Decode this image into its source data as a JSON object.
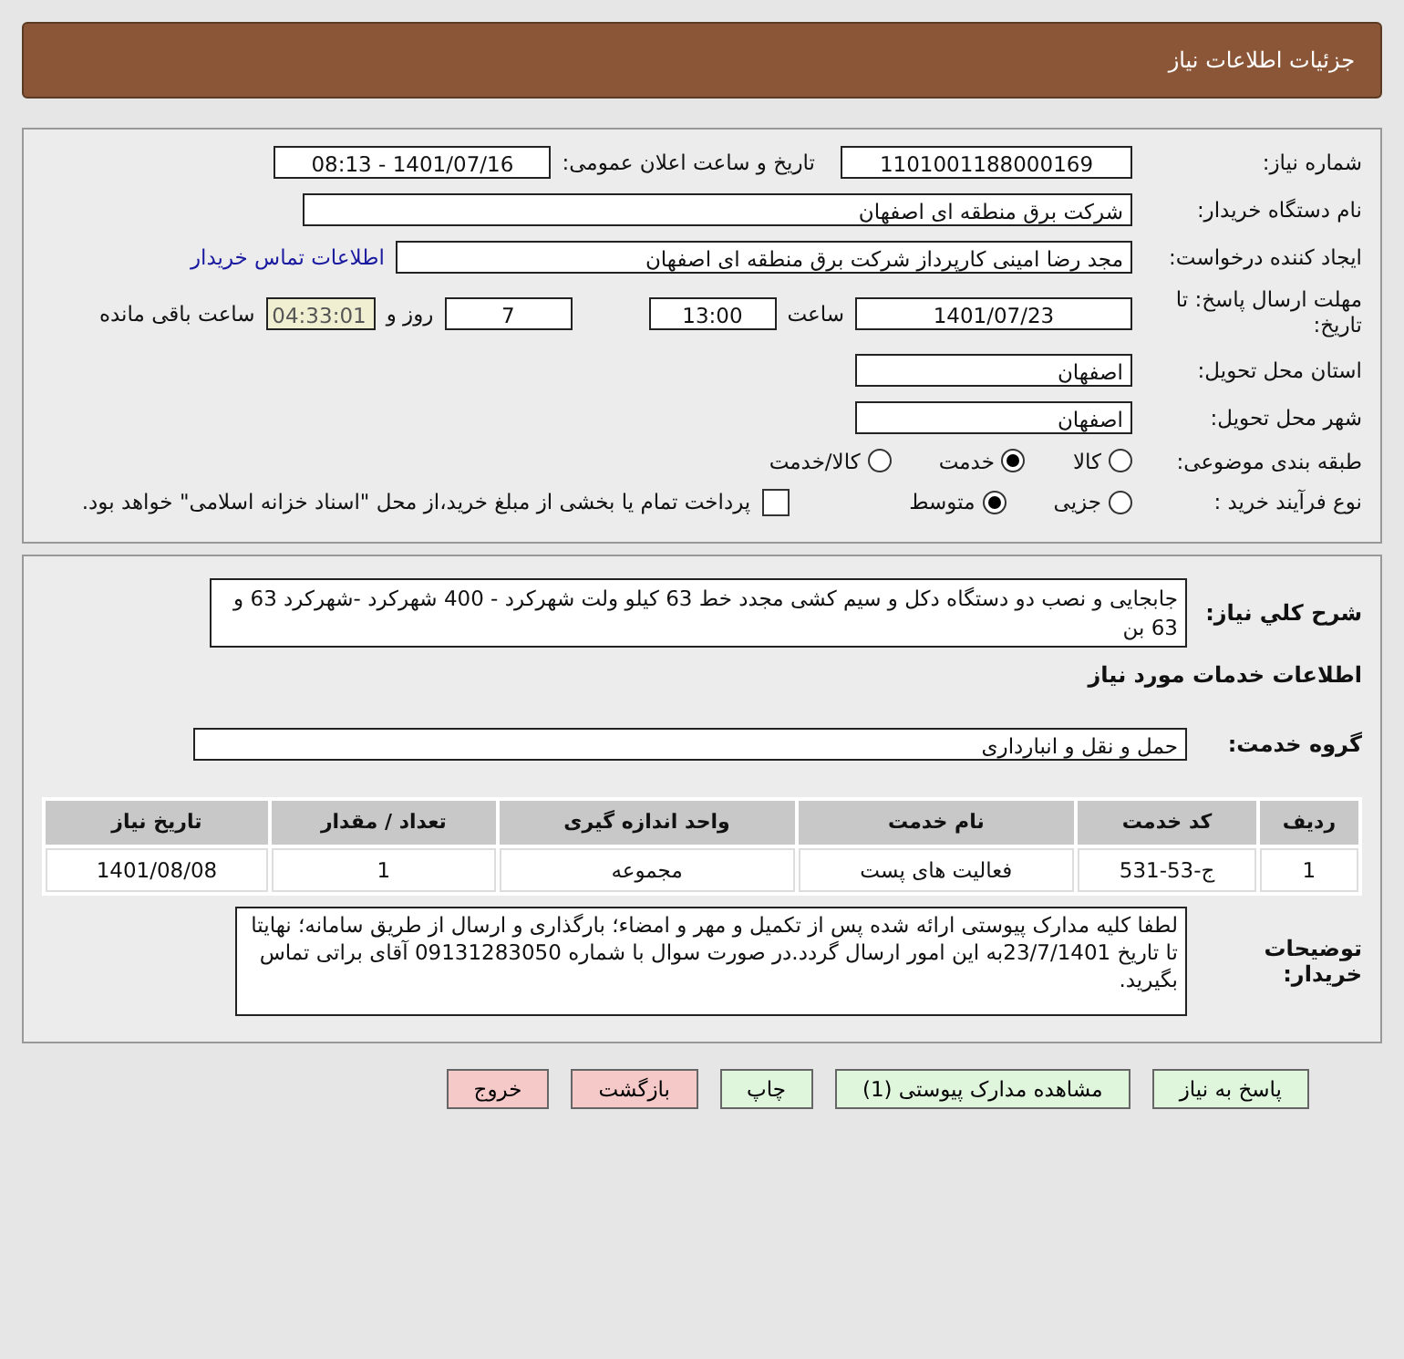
{
  "header": {
    "title": "جزئیات اطلاعات نیاز"
  },
  "need_number": {
    "label": "شماره نیاز:",
    "value": "1101001188000169"
  },
  "announce": {
    "label": "تاریخ و ساعت اعلان عمومی:",
    "value": "1401/07/16 - 08:13"
  },
  "buyer_org": {
    "label": "نام دستگاه خریدار:",
    "value": "شرکت برق منطقه ای اصفهان"
  },
  "creator": {
    "label": "ایجاد کننده درخواست:",
    "value": "مجد رضا امینی کارپرداز شرکت برق منطقه ای اصفهان",
    "link": "اطلاعات تماس خریدار"
  },
  "deadline": {
    "label": "مهلت ارسال پاسخ: تا تاریخ:",
    "date": "1401/07/23",
    "time_label": "ساعت",
    "time": "13:00",
    "days": "7",
    "days_label": "روز و",
    "remaining": "04:33:01",
    "remaining_label": "ساعت باقی مانده"
  },
  "province": {
    "label": "استان محل تحویل:",
    "value": "اصفهان"
  },
  "city": {
    "label": "شهر محل تحویل:",
    "value": "اصفهان"
  },
  "category": {
    "label": "طبقه بندی موضوعی:",
    "options": [
      {
        "label": "کالا",
        "selected": false
      },
      {
        "label": "خدمت",
        "selected": true
      },
      {
        "label": "کالا/خدمت",
        "selected": false
      }
    ]
  },
  "process": {
    "label": "نوع فرآیند خرید :",
    "options": [
      {
        "label": "جزیی",
        "selected": false
      },
      {
        "label": "متوسط",
        "selected": true
      }
    ],
    "payment": {
      "checked": false,
      "label": "پرداخت تمام یا بخشی از مبلغ خرید،از محل \"اسناد خزانه اسلامی\" خواهد بود."
    }
  },
  "description": {
    "label": "شرح کلي نیاز:",
    "value": "جابجایی و نصب دو دستگاه دکل و سیم کشی مجدد خط 63 کیلو ولت شهرکرد - 400 شهرکرد -شهرکرد 63 و 63 بن"
  },
  "services_heading": "اطلاعات خدمات مورد نیاز",
  "service_group": {
    "label": "گروه خدمت:",
    "value": "حمل و نقل و انبارداری"
  },
  "table": {
    "columns": [
      "ردیف",
      "کد خدمت",
      "نام خدمت",
      "واحد اندازه گیری",
      "تعداد / مقدار",
      "تاریخ نیاز"
    ],
    "rows": [
      [
        "1",
        "ج-53-531",
        "فعالیت های پست",
        "مجموعه",
        "1",
        "1401/08/08"
      ]
    ]
  },
  "buyer_notes": {
    "label": "توضیحات خریدار:",
    "value": "لطفا کلیه مدارک پیوستی ارائه شده  پس از تکمیل و مهر و امضاء؛ بارگذاری و ارسال از طریق سامانه؛ نهایتا تا تاریخ 23/7/1401به این امور ارسال گردد.در صورت سوال با شماره 09131283050 آقای براتی تماس بگیرید."
  },
  "buttons": [
    {
      "label": "پاسخ به نیاز",
      "kind": "green"
    },
    {
      "label": "مشاهده مدارک پیوستی (1)",
      "kind": "green"
    },
    {
      "label": "چاپ",
      "kind": "green"
    },
    {
      "label": "بازگشت",
      "kind": "pink"
    },
    {
      "label": "خروج",
      "kind": "pink"
    }
  ]
}
